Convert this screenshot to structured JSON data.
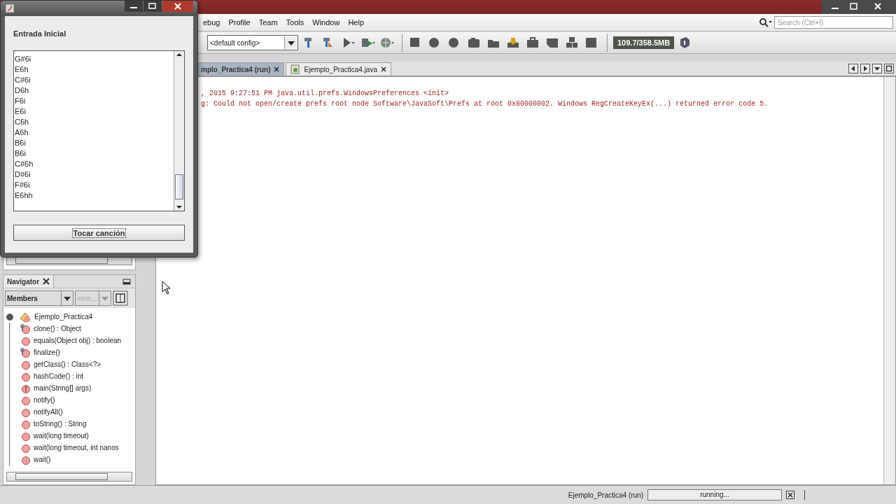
{
  "ide": {
    "menu": [
      {
        "label": "ebug"
      },
      {
        "label": "Profile"
      },
      {
        "label": "Team"
      },
      {
        "label": "Tools"
      },
      {
        "label": "Window"
      },
      {
        "label": "Help"
      }
    ],
    "search": {
      "placeholder": "Search (Ctrl+I)"
    },
    "config": "<default config>",
    "memory": "109.7/358.5MB",
    "tabs": [
      {
        "label": "mplo_Practica4 (run)",
        "selected": true
      },
      {
        "label": "Ejemplo_Practica4.java",
        "selected": false
      }
    ],
    "output": [
      ", 2015 9:27:51 PM java.util.prefs.WindowsPreferences <init>",
      "g: Could not open/create prefs root node Software\\JavaSoft\\Prefs at root 0x80000002. Windows RegCreateKeyEx(...) returned error code 5."
    ]
  },
  "navigator": {
    "title": "Navigator",
    "filter": "Members",
    "secondary": "<em...",
    "tree": {
      "label": "Ejemplo_Practica4",
      "expanded": true,
      "children": [
        {
          "label": "clone() : Object",
          "kind": "protected"
        },
        {
          "label": "equals(Object obj) : boolean",
          "kind": "method"
        },
        {
          "label": "finalize()",
          "kind": "protected"
        },
        {
          "label": "getClass() : Class<?>",
          "kind": "method"
        },
        {
          "label": "hashCode() : int",
          "kind": "method"
        },
        {
          "label": "main(String[] args)",
          "kind": "static"
        },
        {
          "label": "notify()",
          "kind": "method"
        },
        {
          "label": "notifyAll()",
          "kind": "method"
        },
        {
          "label": "toString() : String",
          "kind": "method"
        },
        {
          "label": "wait(long timeout)",
          "kind": "method"
        },
        {
          "label": "wait(long timeout, int nanos",
          "kind": "method"
        },
        {
          "label": "wait()",
          "kind": "method"
        }
      ]
    }
  },
  "status_bar": {
    "task": "Ejemplo_Practica4 (run)",
    "progress": "running..."
  },
  "dialog": {
    "heading": "Entrada Inicial",
    "items": [
      "G#6i",
      "E6h",
      "C#6i",
      "D6h",
      "F6i",
      "E6i",
      "C6h",
      "A6h",
      "B6i",
      "B6i",
      "C#6h",
      "D#6i",
      "F#6i",
      "E6hh"
    ],
    "button": "Tocar canción"
  }
}
